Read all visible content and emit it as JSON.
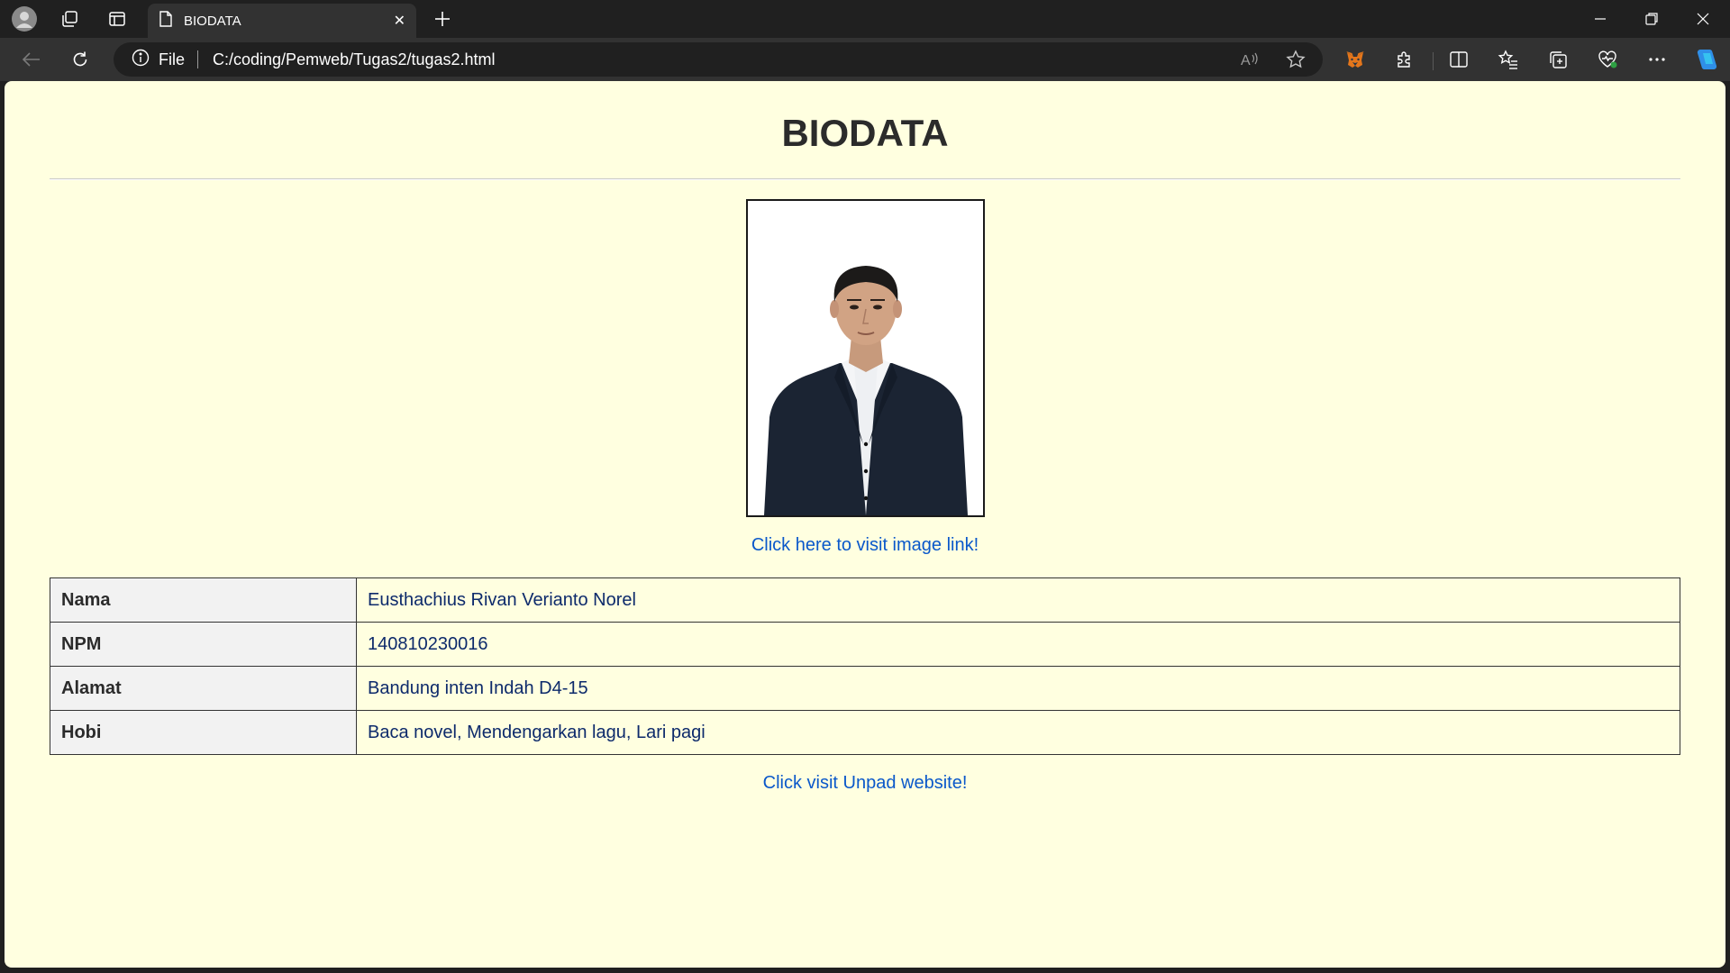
{
  "browser": {
    "tab_title": "BIODATA",
    "address_scheme": "File",
    "address_url": "C:/coding/Pemweb/Tugas2/tugas2.html"
  },
  "page": {
    "title": "BIODATA",
    "image_link_text": "Click here to visit image link!",
    "unpad_link_text": "Click visit Unpad website!"
  },
  "biodata": {
    "rows": [
      {
        "label": "Nama",
        "value": "Eusthachius Rivan Verianto Norel"
      },
      {
        "label": "NPM",
        "value": "140810230016"
      },
      {
        "label": "Alamat",
        "value": "Bandung inten Indah D4-15"
      },
      {
        "label": "Hobi",
        "value": "Baca novel, Mendengarkan lagu, Lari pagi"
      }
    ]
  },
  "colors": {
    "page_background": "#ffffe0",
    "link": "#0a58ca",
    "table_value_text": "#0d2a6b",
    "browser_chrome": "#202020"
  }
}
